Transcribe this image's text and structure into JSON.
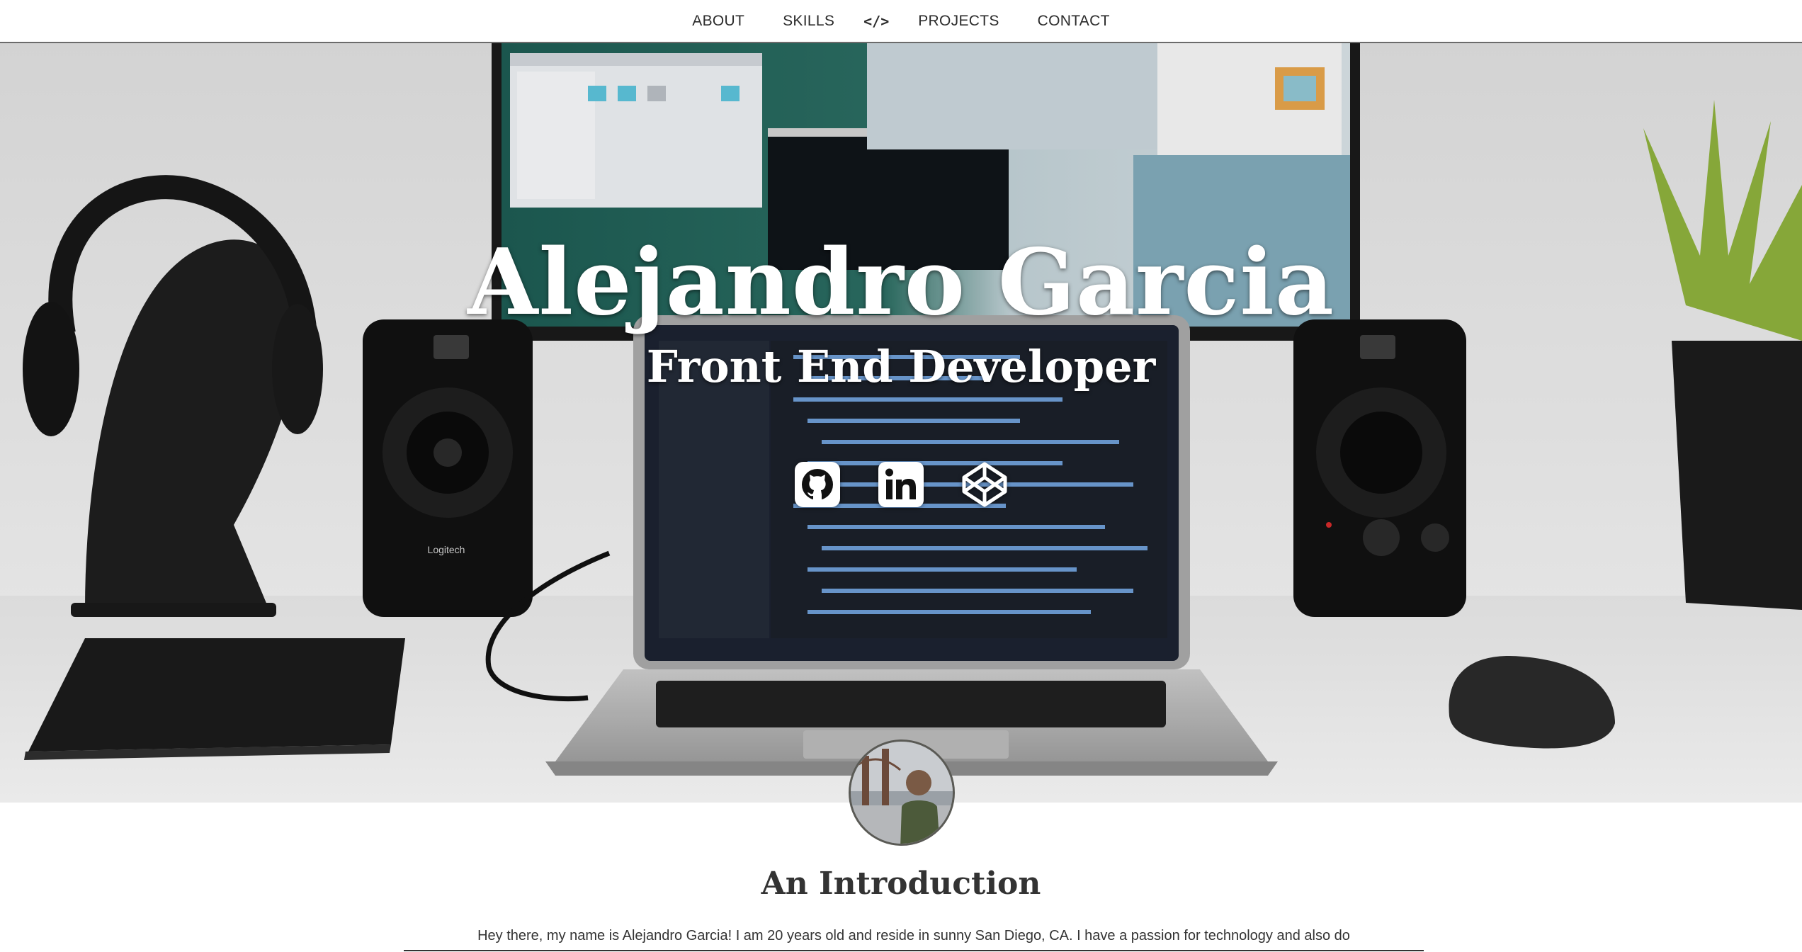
{
  "nav": {
    "items": [
      "ABOUT",
      "SKILLS",
      "PROJECTS",
      "CONTACT"
    ],
    "logo": "</>",
    "logo_icon": "code-brackets-icon"
  },
  "hero": {
    "name": "Alejandro Garcia",
    "title": "Front End Developer",
    "social": [
      {
        "id": "github",
        "icon": "github-icon"
      },
      {
        "id": "linkedin",
        "icon": "linkedin-icon"
      },
      {
        "id": "codepen",
        "icon": "codepen-icon"
      }
    ]
  },
  "about": {
    "heading": "An Introduction",
    "text": "Hey there, my name is Alejandro Garcia! I am 20 years old and reside in sunny San Diego, CA. I have a passion for technology and also do"
  },
  "colors": {
    "text": "#333333",
    "nav_border": "#6b6b6b",
    "hero_text": "#ffffff"
  }
}
